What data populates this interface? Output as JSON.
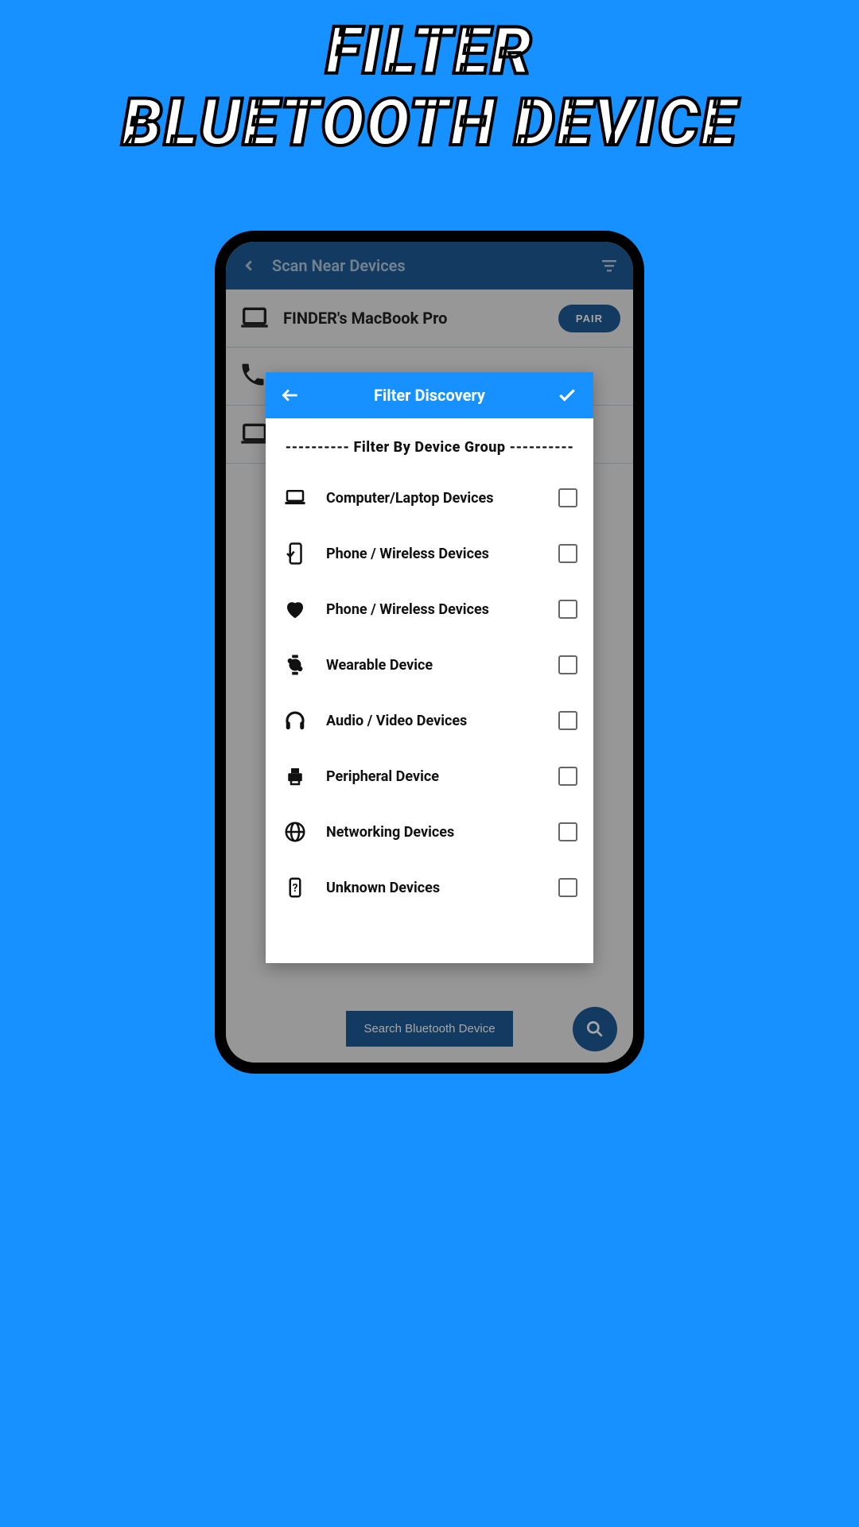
{
  "promo": {
    "line1": "FILTER",
    "line2": "BLUETOOTH DEVICE"
  },
  "app": {
    "header_title": "Scan Near Devices",
    "devices": [
      {
        "name": "FINDER's MacBook Pro",
        "icon": "laptop",
        "action": "PAIR"
      }
    ],
    "search_button": "Search Bluetooth Device"
  },
  "dialog": {
    "title": "Filter Discovery",
    "section": "---------- Filter By Device Group ----------",
    "options": [
      {
        "icon": "laptop",
        "label": "Computer/Laptop Devices",
        "checked": false
      },
      {
        "icon": "phone-check",
        "label": "Phone / Wireless Devices",
        "checked": false
      },
      {
        "icon": "heart",
        "label": "Phone / Wireless Devices",
        "checked": false
      },
      {
        "icon": "watch",
        "label": "Wearable Device",
        "checked": false
      },
      {
        "icon": "headphones",
        "label": "Audio / Video Devices",
        "checked": false
      },
      {
        "icon": "printer",
        "label": "Peripheral Device",
        "checked": false
      },
      {
        "icon": "globe",
        "label": "Networking Devices",
        "checked": false
      },
      {
        "icon": "unknown",
        "label": "Unknown Devices",
        "checked": false
      }
    ]
  },
  "colors": {
    "bg": "#1791ff",
    "header": "#1e5a94"
  }
}
